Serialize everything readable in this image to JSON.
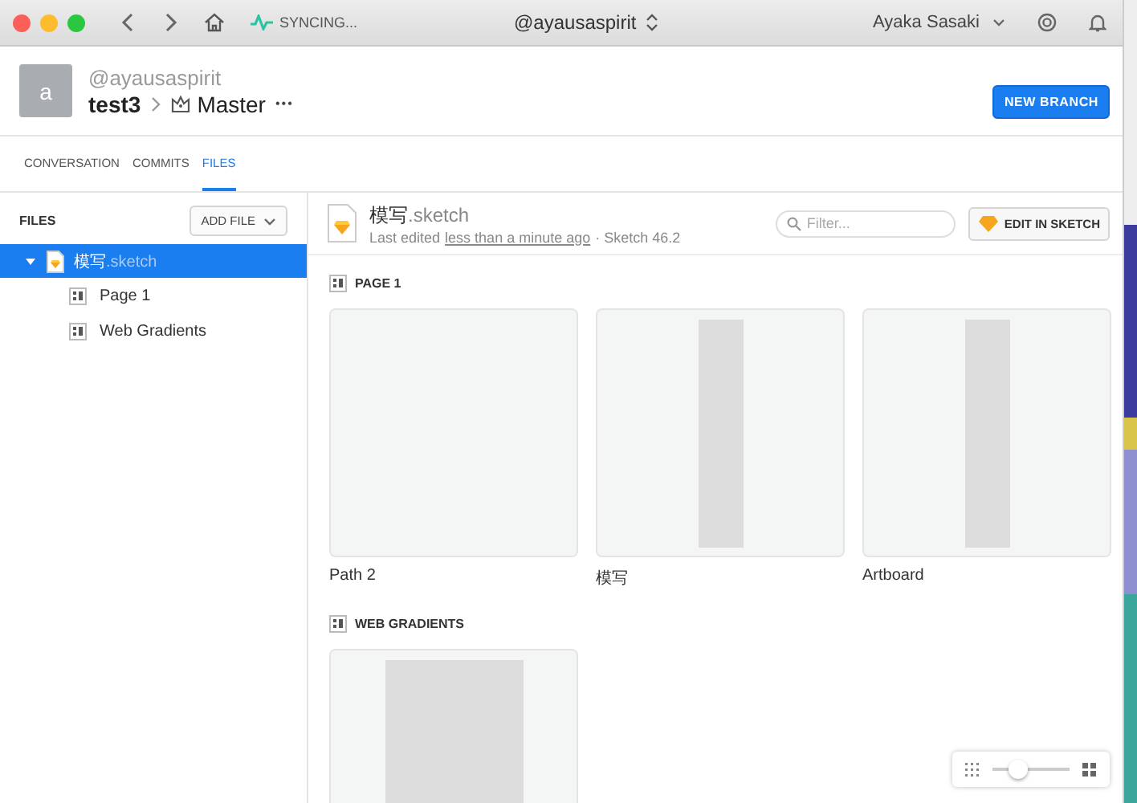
{
  "titlebar": {
    "syncing": "SYNCING...",
    "account": "@ayausaspirit",
    "user": "Ayaka Sasaki"
  },
  "header": {
    "avatar_letter": "a",
    "handle": "@ayausaspirit",
    "project": "test3",
    "branch": "Master",
    "more": "•••",
    "new_branch": "NEW BRANCH"
  },
  "tabs": [
    {
      "label": "CONVERSATION",
      "selected": false
    },
    {
      "label": "COMMITS",
      "selected": false
    },
    {
      "label": "FILES",
      "selected": true
    }
  ],
  "sidebar": {
    "title": "FILES",
    "add_file": "ADD FILE",
    "tree": [
      {
        "name_main": "模写",
        "name_ext": ".sketch",
        "selected": true,
        "expanded": true,
        "children": [
          {
            "name": "Page 1",
            "selected": false
          },
          {
            "name": "Web Gradients",
            "selected": false
          }
        ]
      }
    ]
  },
  "file": {
    "name_main": "模写",
    "name_ext": ".sketch",
    "edited_prefix": "Last edited",
    "edited_link": "less than a minute ago",
    "edited_suffix": "· Sketch 46.2",
    "filter_placeholder": "Filter...",
    "edit_button": "EDIT IN SKETCH"
  },
  "pages": [
    {
      "title": "PAGE 1",
      "artboards": [
        {
          "name": "Path 2",
          "kind": "blank"
        },
        {
          "name": "模写",
          "kind": "tall"
        },
        {
          "name": "Artboard",
          "kind": "tall"
        }
      ]
    },
    {
      "title": "WEB GRADIENTS",
      "artboards": [
        {
          "kind": "wide"
        }
      ]
    }
  ],
  "zoom": {
    "level": 0.3
  }
}
